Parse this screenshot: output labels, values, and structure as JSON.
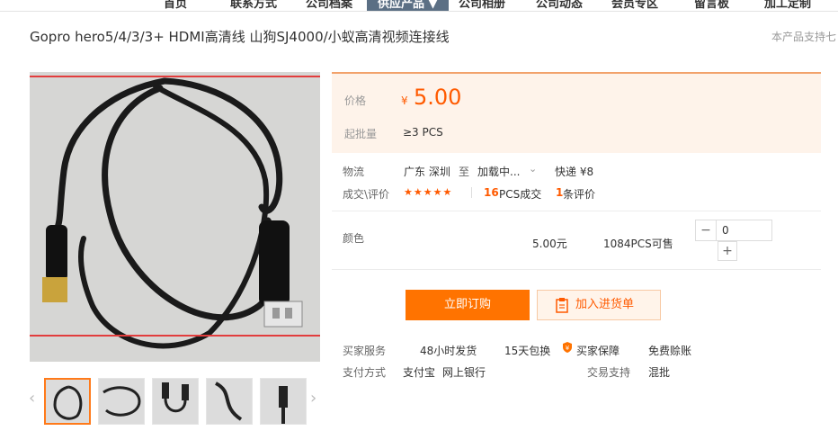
{
  "nav": {
    "items": [
      {
        "label": "首页"
      },
      {
        "label": "联系方式"
      },
      {
        "label": "公司档案"
      },
      {
        "label": "供应产品 ▼"
      },
      {
        "label": "公司相册"
      },
      {
        "label": "公司动态"
      },
      {
        "label": "会员专区"
      },
      {
        "label": "留言板"
      },
      {
        "label": "加工定制"
      }
    ]
  },
  "product": {
    "title": "Gopro hero5/4/3/3+ HDMI高清线 山狗SJ4000/小蚁高清视频连接线",
    "support_text": "本产品支持七"
  },
  "price": {
    "label": "价格",
    "currency": "¥",
    "value": "5.00",
    "moq_label": "起批量",
    "moq_value": "≥3 PCS"
  },
  "logistics": {
    "label": "物流",
    "from": "广东 深圳",
    "to_word": "至",
    "to": "加载中...",
    "shipping": "快递 ¥8"
  },
  "reviews": {
    "label": "成交\\评价",
    "stars": "★★★★★",
    "sold_count": "16",
    "sold_suffix": "PCS成交",
    "review_count": "1",
    "review_suffix": "条评价"
  },
  "variant": {
    "label": "颜色",
    "price": "5.00元",
    "stock": "1084PCS可售",
    "quantity": "0",
    "minus": "−",
    "plus": "+"
  },
  "actions": {
    "order": "立即订购",
    "cart": "加入进货单"
  },
  "service": {
    "label": "买家服务",
    "items": [
      "48小时发货",
      "15天包换",
      "买家保障",
      "免费赊账"
    ]
  },
  "payment": {
    "label": "支付方式",
    "methods": [
      "支付宝",
      "网上银行"
    ],
    "trade_label": "交易支持",
    "trade_value": "混批"
  },
  "colors": {
    "accent": "#ff5a00",
    "button": "#ff7300",
    "price_bg": "#fef3ea",
    "highlight_border": "#e23d3d"
  }
}
